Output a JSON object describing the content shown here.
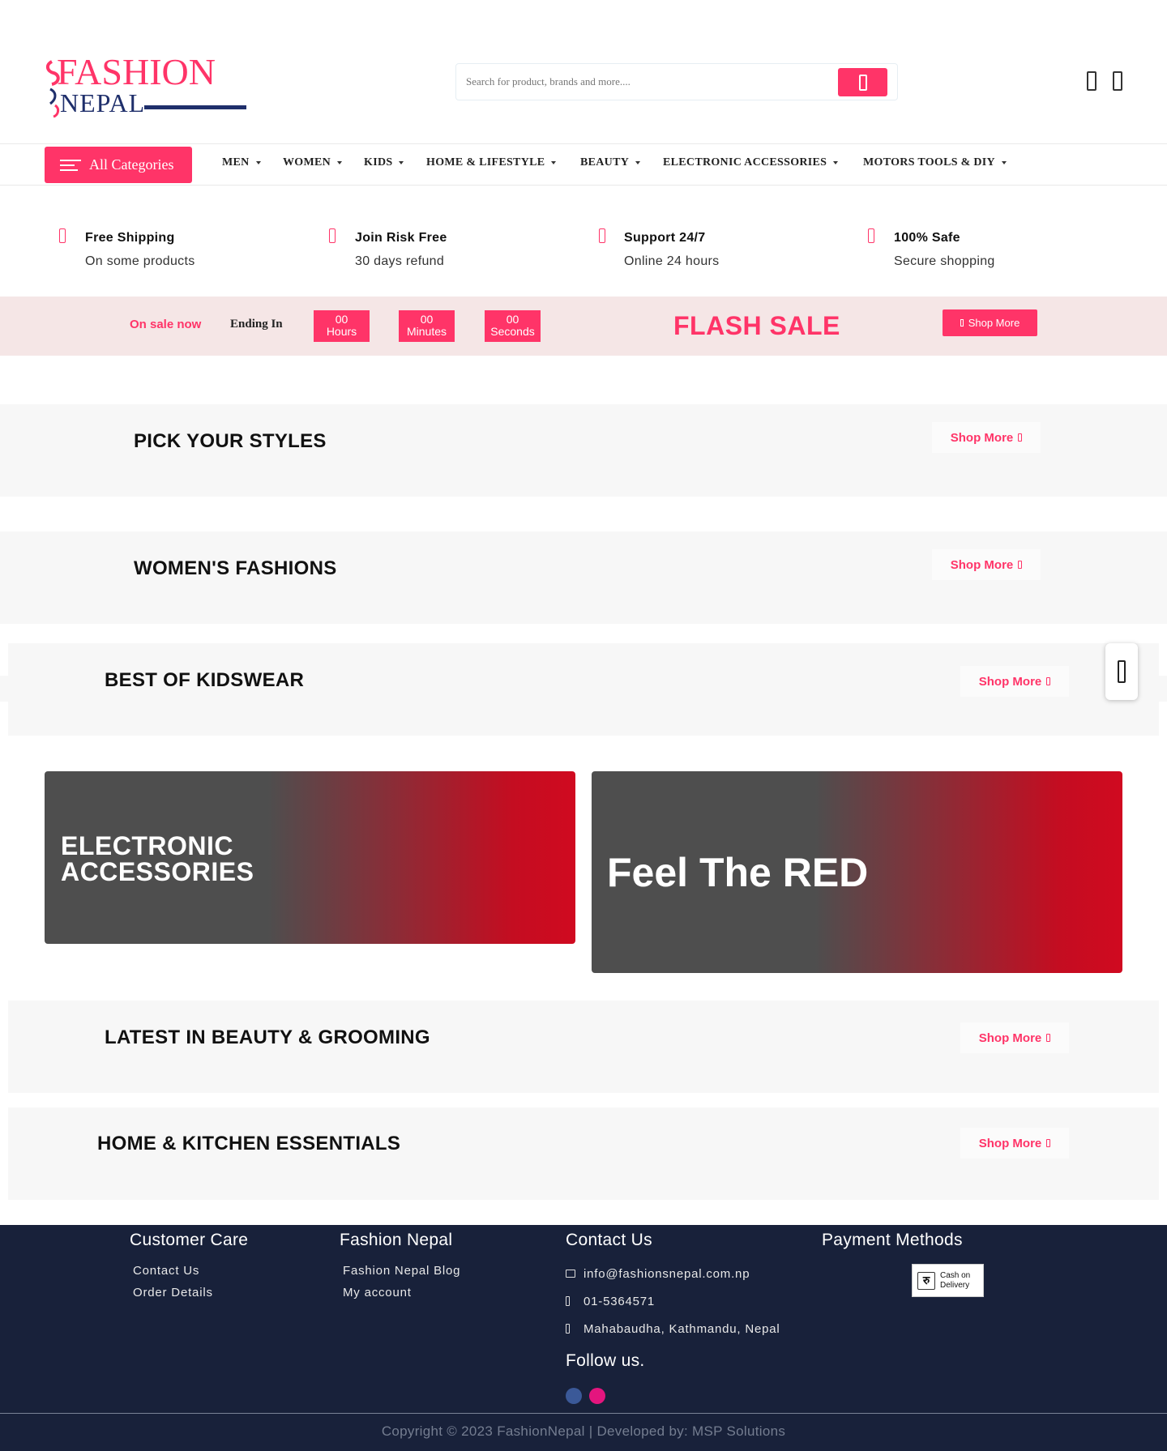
{
  "brand": {
    "logo_line1": "FASHION",
    "logo_line2": "NEPAL",
    "accent": "#ff3468",
    "footer_bg": "#18213a"
  },
  "search": {
    "placeholder": "Search for product, brands and more...."
  },
  "header_icons": [
    "user-icon",
    "cart-icon"
  ],
  "nav": {
    "all_categories": "All Categories",
    "items": [
      "MEN",
      "WOMEN",
      "KIDS",
      "HOME & LIFESTYLE",
      "BEAUTY",
      "ELECTRONIC ACCESSORIES",
      "MOTORS TOOLS & DIY"
    ]
  },
  "features": [
    {
      "title": "Free Shipping",
      "sub": "On some products"
    },
    {
      "title": "Join Risk Free",
      "sub": "30 days refund"
    },
    {
      "title": "Support 24/7",
      "sub": "Online 24 hours"
    },
    {
      "title": "100% Safe",
      "sub": "Secure shopping"
    }
  ],
  "flash": {
    "on_sale": "On sale now",
    "ending_in": "Ending In",
    "hours_val": "00",
    "hours_label": "Hours",
    "minutes_val": "00",
    "minutes_label": "Minutes",
    "seconds_val": "00",
    "seconds_label": "Seconds",
    "title": "FLASH SALE",
    "shop_more": "Shop More"
  },
  "sections": {
    "pick_styles": "PICK YOUR STYLES",
    "womens": "WOMEN'S FASHIONS",
    "kidswear": "BEST OF KIDSWEAR",
    "beauty": "LATEST IN BEAUTY & GROOMING",
    "home_kitchen": "HOME & KITCHEN ESSENTIALS",
    "shop_more": "Shop More"
  },
  "banners": {
    "left_line1": "ELECTRONIC",
    "left_line2": "ACCESSORIES",
    "right": "Feel The RED"
  },
  "footer": {
    "customer_care": {
      "heading": "Customer Care",
      "links": [
        "Contact Us",
        "Order Details"
      ]
    },
    "fashion_nepal": {
      "heading": "Fashion Nepal",
      "links": [
        "Fashion Nepal Blog",
        "My account"
      ]
    },
    "contact": {
      "heading": "Contact Us",
      "email": "info@fashionsnepal.com.np",
      "phone": "01-5364571",
      "address": "Mahabaudha, Kathmandu, Nepal"
    },
    "follow": "Follow us.",
    "payment": {
      "heading": "Payment Methods",
      "cod_line1": "Cash on",
      "cod_line2": "Delivery",
      "cod_symbol": "रु"
    },
    "copyright": "Copyright © 2023 FashionNepal | Developed by: MSP Solutions"
  }
}
